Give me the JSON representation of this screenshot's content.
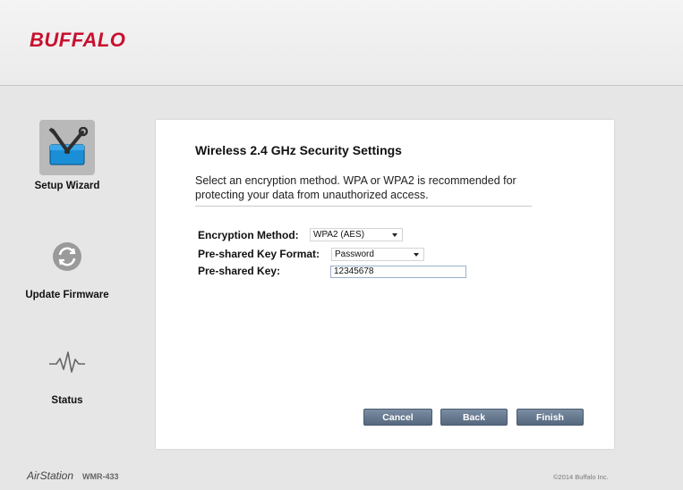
{
  "header": {
    "logo_text": "BUFFALO",
    "brand_color": "#c8102e"
  },
  "sidebar": {
    "items": [
      {
        "label": "Setup Wizard",
        "icon": "setup-wizard-icon",
        "active": true
      },
      {
        "label": "Update Firmware",
        "icon": "update-firmware-icon",
        "active": false
      },
      {
        "label": "Status",
        "icon": "status-pulse-icon",
        "active": false
      }
    ]
  },
  "panel": {
    "title": "Wireless 2.4 GHz Security Settings",
    "description": "Select an encryption method. WPA or WPA2 is recommended for protecting your data from unauthorized access.",
    "fields": {
      "encryption_method": {
        "label": "Encryption Method:",
        "value": "WPA2 (AES)"
      },
      "key_format": {
        "label": "Pre-shared Key Format:",
        "value": "Password"
      },
      "preshared_key": {
        "label": "Pre-shared Key:",
        "value": "12345678"
      }
    },
    "buttons": {
      "cancel": "Cancel",
      "back": "Back",
      "finish": "Finish"
    }
  },
  "footer": {
    "brand": "AirStation",
    "model": "WMR-433",
    "copyright": "©2014 Buffalo Inc."
  }
}
